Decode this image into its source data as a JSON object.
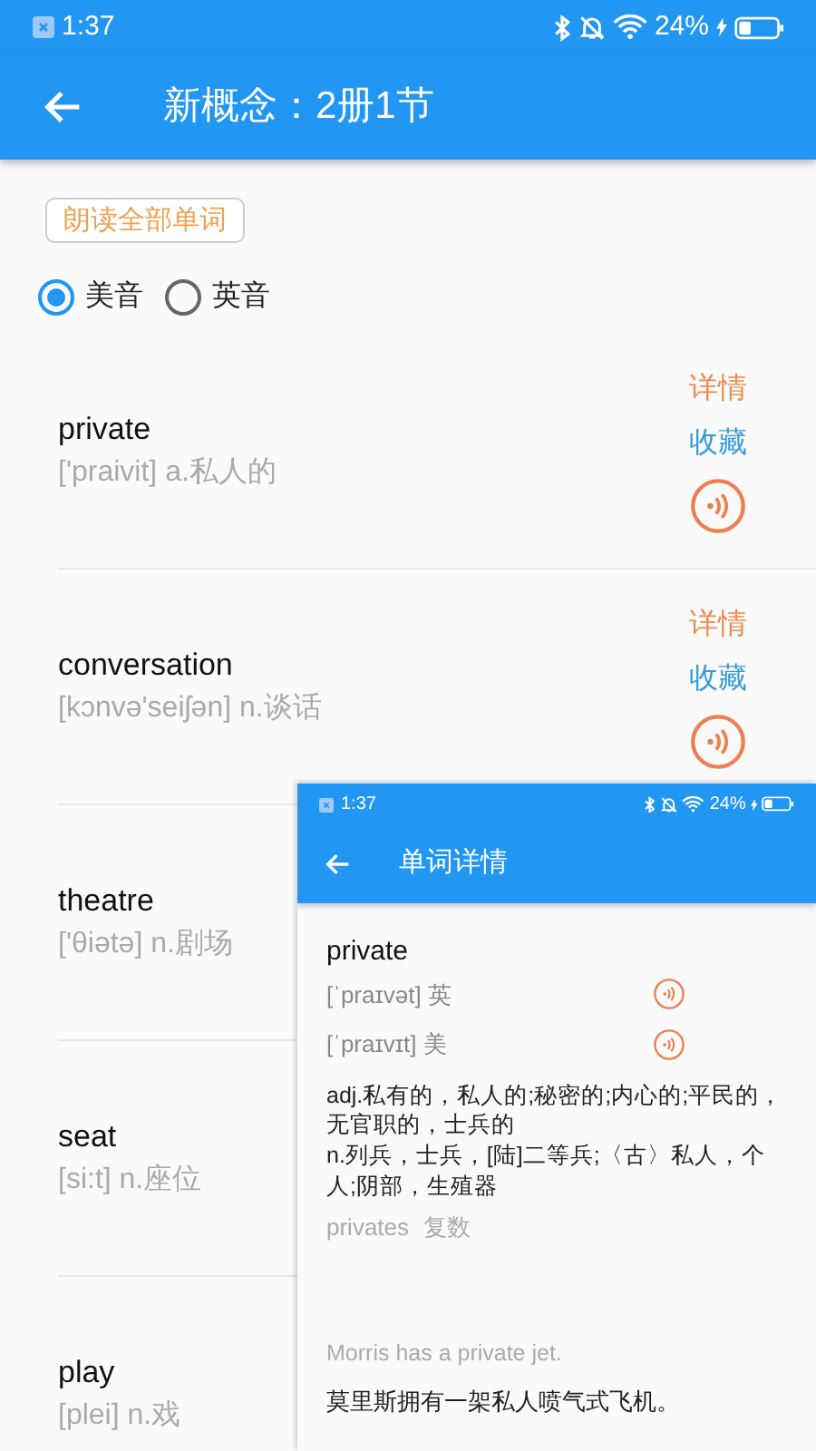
{
  "status_bar": {
    "time": "1:37",
    "battery": "24%"
  },
  "app_bar": {
    "title": "新概念：2册1节"
  },
  "read_all_button": "朗读全部单词",
  "accents": [
    {
      "label": "美音",
      "selected": true
    },
    {
      "label": "英音",
      "selected": false
    }
  ],
  "words": [
    {
      "word": "private",
      "phonetic": "['praivit] a.私人的",
      "actions": {
        "detail": "详情",
        "favorite": "收藏"
      }
    },
    {
      "word": "conversation",
      "phonetic": "[kɔnvə'seiʃən] n.谈话",
      "actions": {
        "detail": "详情",
        "favorite": "收藏"
      }
    },
    {
      "word": "theatre",
      "phonetic": "['θiətə] n.剧场"
    },
    {
      "word": "seat",
      "phonetic": "[si:t] n.座位"
    },
    {
      "word": "play",
      "phonetic": "[plei] n.戏"
    }
  ],
  "overlay": {
    "status_bar": {
      "time": "1:37",
      "battery": "24%"
    },
    "title": "单词详情",
    "word": "private",
    "pronunciations": [
      {
        "text": "[ˈpraɪvət] 英"
      },
      {
        "text": "[ˈpraɪvɪt] 美"
      }
    ],
    "definitions": [
      "adj.私有的，私人的;秘密的;内心的;平民的，无官职的，士兵的",
      "n.列兵，士兵，[陆]二等兵;〈古〉私人，个人;阴部，生殖器"
    ],
    "plural": {
      "form": "privates",
      "label": "复数"
    },
    "example": {
      "en": "Morris has a private jet.",
      "zh": "莫里斯拥有一架私人喷气式飞机。"
    }
  }
}
